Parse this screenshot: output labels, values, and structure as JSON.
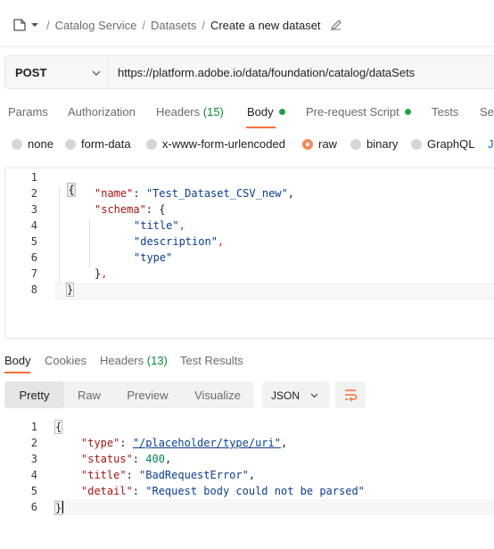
{
  "breadcrumb": {
    "items": [
      "Catalog Service",
      "Datasets"
    ],
    "current": "Create a new dataset",
    "separator": "/"
  },
  "request": {
    "method": "POST",
    "url": "https://platform.adobe.io/data/foundation/catalog/dataSets"
  },
  "tabs": {
    "params": "Params",
    "authorization": "Authorization",
    "headers": "Headers",
    "headers_count": "(15)",
    "body": "Body",
    "prerequest": "Pre-request Script",
    "tests": "Tests",
    "settings": "Se"
  },
  "body_types": {
    "none": "none",
    "formdata": "form-data",
    "urlencoded": "x-www-form-urlencoded",
    "raw": "raw",
    "binary": "binary",
    "graphql": "GraphQL",
    "json_cut": "J"
  },
  "request_body": {
    "line_numbers": [
      "1",
      "2",
      "3",
      "4",
      "5",
      "6",
      "7",
      "8"
    ],
    "open_brace": "{",
    "name_key": "\"name\"",
    "name_value": "\"Test_Dataset_CSV_new\"",
    "schema_key": "\"schema\"",
    "schema_open": "{",
    "title_str": "\"title\"",
    "description_str": "\"description\"",
    "type_str": "\"type\"",
    "schema_close": "}",
    "close_brace": "}",
    "colon": ": ",
    "comma": ","
  },
  "response": {
    "tabs": {
      "body": "Body",
      "cookies": "Cookies",
      "headers": "Headers",
      "headers_count": "(13)",
      "results": "Test Results"
    },
    "views": {
      "pretty": "Pretty",
      "raw": "Raw",
      "preview": "Preview",
      "visualize": "Visualize"
    },
    "format": "JSON",
    "line_numbers": [
      "1",
      "2",
      "3",
      "4",
      "5",
      "6"
    ],
    "open_brace": "{",
    "type_key": "\"type\"",
    "type_value": "\"/placeholder/type/uri\"",
    "status_key": "\"status\"",
    "status_value": "400",
    "title_key": "\"title\"",
    "title_value": "\"BadRequestError\"",
    "detail_key": "\"detail\"",
    "detail_value": "\"Request body could not be parsed\"",
    "close_brace": "}",
    "colon": ": ",
    "comma": ","
  },
  "colors": {
    "accent": "#ff6c37",
    "active_dot": "#1fa34a",
    "count_green": "#0a8a3a",
    "error_squiggle": "#e0271e",
    "link_blue": "#0b3d91"
  },
  "icons": [
    "collection-icon",
    "chevron-down-icon",
    "edit-icon",
    "wrap-lines-icon"
  ]
}
